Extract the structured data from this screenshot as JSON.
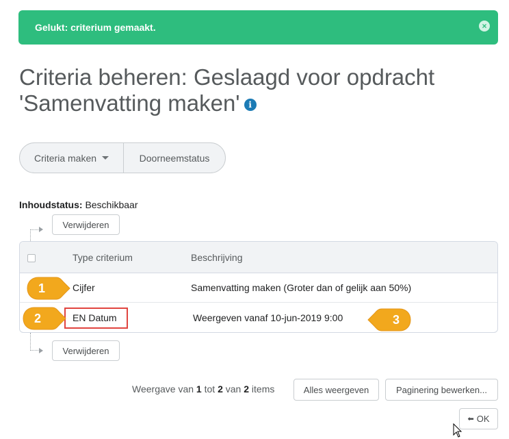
{
  "alert": {
    "message": "Gelukt: criterium gemaakt.",
    "close_icon": "×"
  },
  "page": {
    "title_line1": "Criteria beheren: Geslaagd voor opdracht",
    "title_line2": "'Samenvatting maken'",
    "info_icon": "i"
  },
  "toolbar": {
    "create_label": "Criteria maken",
    "review_label": "Doorneemstatus"
  },
  "content_status": {
    "label": "Inhoudstatus:",
    "value": "Beschikbaar"
  },
  "actions": {
    "delete_top": "Verwijderen",
    "delete_bottom": "Verwijderen"
  },
  "table": {
    "columns": [
      "Type criterium",
      "Beschrijving"
    ],
    "rows": [
      {
        "type": "Cijfer",
        "description": "Samenvatting maken (Groter dan of gelijk aan 50%)"
      },
      {
        "type": "EN Datum",
        "description": "Weergeven vanaf 10-jun-2019 9:00"
      }
    ]
  },
  "callouts": [
    "1",
    "2",
    "3"
  ],
  "pagination": {
    "prefix": "Weergave van",
    "from": "1",
    "to_word": "tot",
    "to": "2",
    "of_word": "van",
    "total": "2",
    "suffix": "items",
    "show_all": "Alles weergeven",
    "edit_paging": "Paginering bewerken..."
  },
  "ok_button": {
    "label": "OK",
    "icon": "back-arrow-icon"
  },
  "colors": {
    "success": "#2ebd7e",
    "callout": "#f2a81d",
    "highlight": "#e0443f",
    "info": "#1c7bb5"
  }
}
